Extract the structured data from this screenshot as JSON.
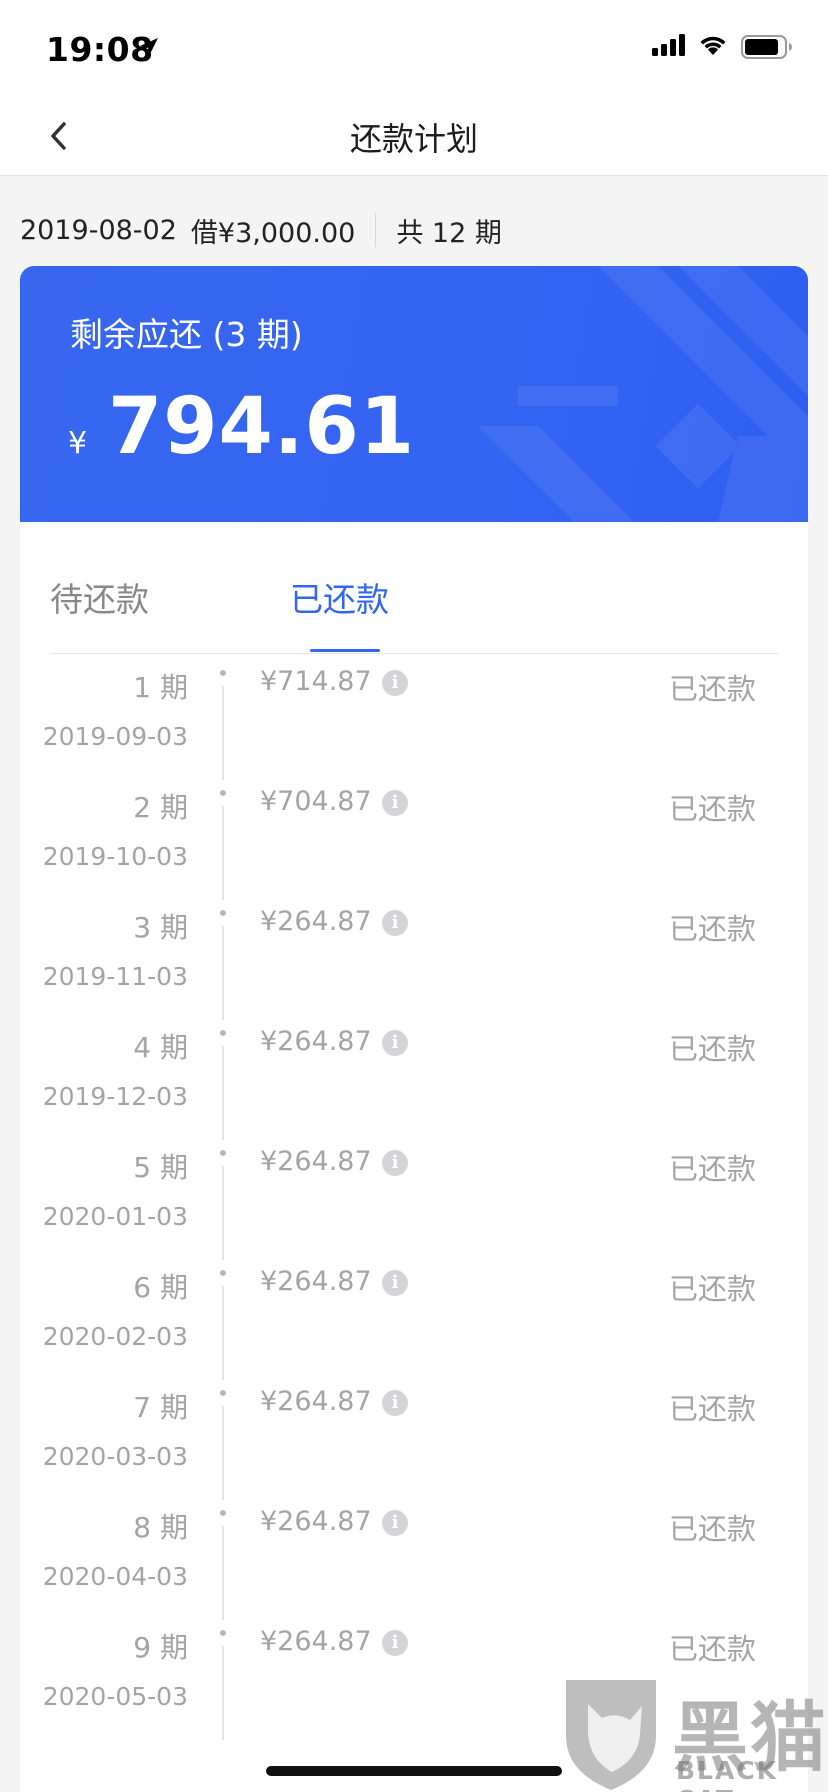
{
  "status_bar": {
    "time": "19:08"
  },
  "nav": {
    "title": "还款计划"
  },
  "loan": {
    "date": "2019-08-02",
    "amount": "借¥3,000.00",
    "periods": "共 12 期"
  },
  "banner": {
    "label": "剩余应还 (3 期)",
    "currency": "¥",
    "amount": "794.61"
  },
  "tabs": {
    "pending": "待还款",
    "paid": "已还款",
    "active": "paid"
  },
  "installments": [
    {
      "period": "1 期",
      "date": "2019-09-03",
      "amount": "¥714.87",
      "status": "已还款"
    },
    {
      "period": "2 期",
      "date": "2019-10-03",
      "amount": "¥704.87",
      "status": "已还款"
    },
    {
      "period": "3 期",
      "date": "2019-11-03",
      "amount": "¥264.87",
      "status": "已还款"
    },
    {
      "period": "4 期",
      "date": "2019-12-03",
      "amount": "¥264.87",
      "status": "已还款"
    },
    {
      "period": "5 期",
      "date": "2020-01-03",
      "amount": "¥264.87",
      "status": "已还款"
    },
    {
      "period": "6 期",
      "date": "2020-02-03",
      "amount": "¥264.87",
      "status": "已还款"
    },
    {
      "period": "7 期",
      "date": "2020-03-03",
      "amount": "¥264.87",
      "status": "已还款"
    },
    {
      "period": "8 期",
      "date": "2020-04-03",
      "amount": "¥264.87",
      "status": "已还款"
    },
    {
      "period": "9 期",
      "date": "2020-05-03",
      "amount": "¥264.87",
      "status": "已还款"
    }
  ],
  "info_icon_glyph": "i",
  "watermark": {
    "cn": "黑猫",
    "en": "BLACK CAT"
  },
  "colors": {
    "accent": "#3366f0",
    "banner": "#3364f2",
    "muted_text": "#a4a4a8"
  }
}
